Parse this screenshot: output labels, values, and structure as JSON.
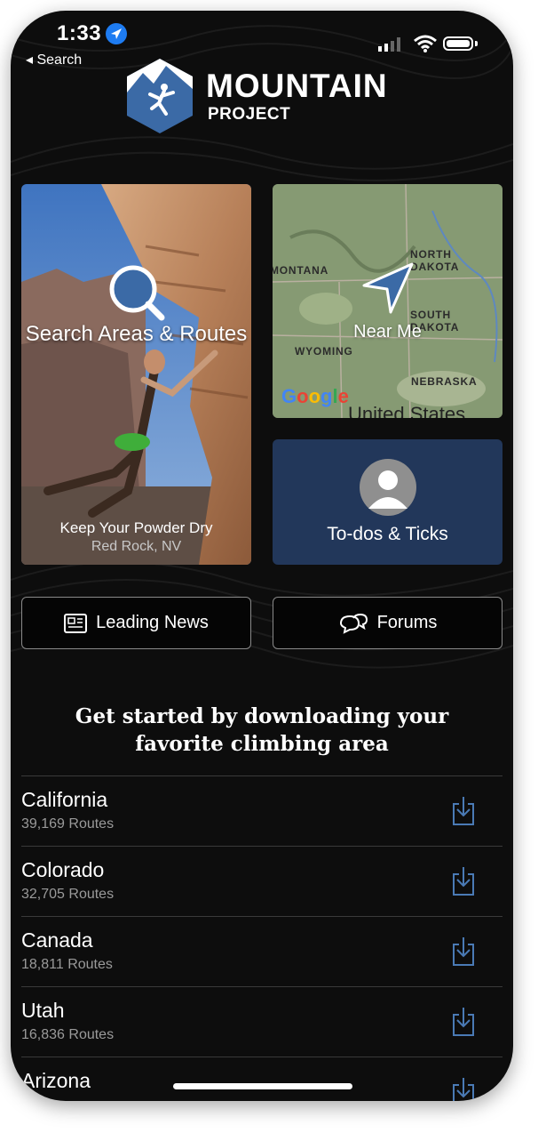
{
  "status_bar": {
    "time": "1:33",
    "back_label": "◂ Search"
  },
  "logo": {
    "line1": "MOUNTAIN",
    "line2": "PROJECT"
  },
  "tiles": {
    "search": {
      "label": "Search Areas & Routes",
      "photo_caption": "Keep Your Powder Dry",
      "photo_location": "Red Rock, NV"
    },
    "near_me": {
      "label": "Near Me",
      "map_labels": [
        "MONTANA",
        "NORTH",
        "DAKOTA",
        "SOUTH",
        "DAKOTA",
        "WYOMING",
        "NEBRASKA"
      ],
      "map_brand": "Google",
      "map_country": "United States"
    },
    "todos": {
      "label": "To-dos & Ticks"
    }
  },
  "buttons": {
    "news": "Leading News",
    "forums": "Forums"
  },
  "get_started": {
    "line1": "Get started by downloading your",
    "line2": "favorite climbing area"
  },
  "areas": [
    {
      "name": "California",
      "routes": "39,169 Routes"
    },
    {
      "name": "Colorado",
      "routes": "32,705 Routes"
    },
    {
      "name": "Canada",
      "routes": "18,811 Routes"
    },
    {
      "name": "Utah",
      "routes": "16,836 Routes"
    },
    {
      "name": "Arizona",
      "routes": ""
    }
  ],
  "colors": {
    "accent": "#4a7ab5",
    "todo_tile": "#22375a",
    "background": "#0d0d0d"
  }
}
